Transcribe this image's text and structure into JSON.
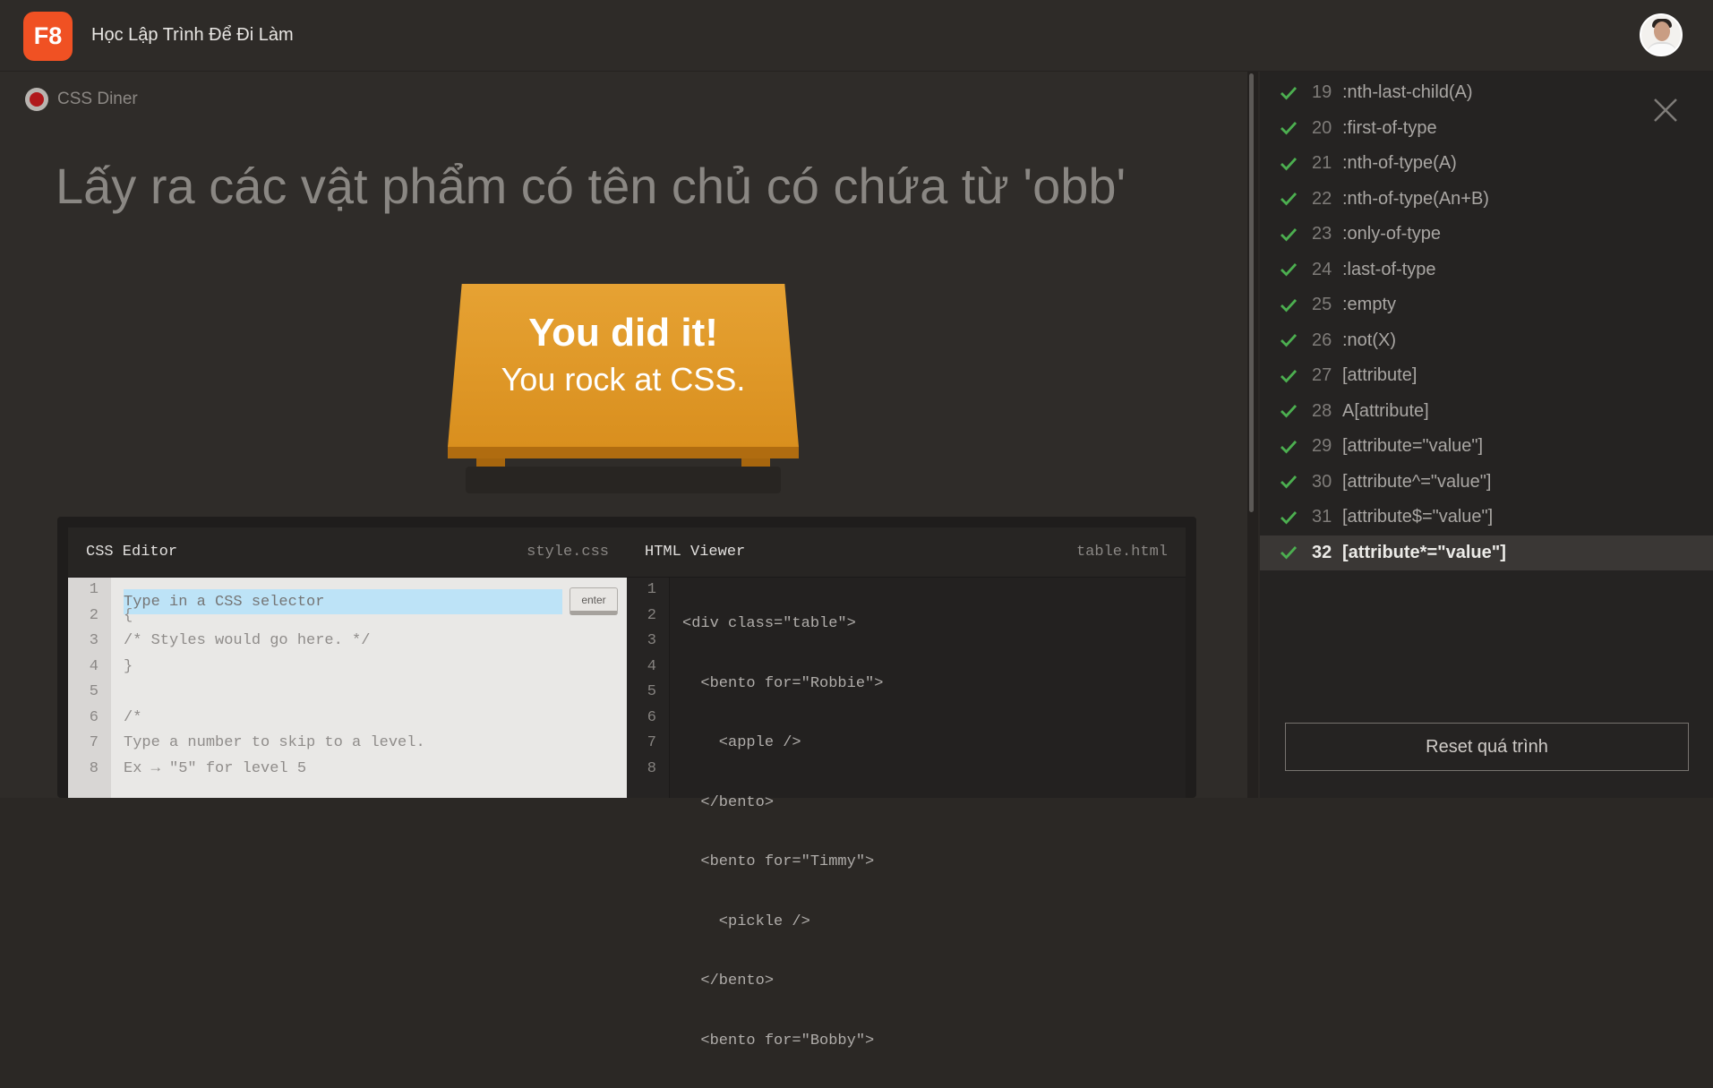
{
  "header": {
    "logo_text": "F8",
    "brand_name": "Học Lập Trình Để Đi Làm",
    "avatar": "user-avatar"
  },
  "game": {
    "app_label": "CSS Diner",
    "instruction": "Lấy ra các vật phẩm có tên chủ có chứa từ 'obb'",
    "table_line1": "You did it!",
    "table_line2": "You rock at CSS."
  },
  "css_editor": {
    "title": "CSS Editor",
    "filename": "style.css",
    "input_placeholder": "Type in a CSS selector",
    "enter_label": "enter",
    "line_numbers": [
      "1",
      "2",
      "3",
      "4",
      "5",
      "6",
      "7",
      "8"
    ],
    "lines": [
      "{",
      "/* Styles would go here. */",
      "}",
      "",
      "/*",
      "Type a number to skip to a level.",
      "Ex → \"5\" for level 5"
    ]
  },
  "html_viewer": {
    "title": "HTML Viewer",
    "filename": "table.html",
    "line_numbers": [
      "1",
      "2",
      "3",
      "4",
      "5",
      "6",
      "7",
      "8"
    ],
    "lines": [
      "<div class=\"table\">",
      "  <bento for=\"Robbie\">",
      "    <apple />",
      "  </bento>",
      "  <bento for=\"Timmy\">",
      "    <pickle />",
      "  </bento>",
      "  <bento for=\"Bobby\">"
    ]
  },
  "sidebar": {
    "levels": [
      {
        "num": "19",
        "label": ":nth-last-child(A)",
        "done": true,
        "active": false
      },
      {
        "num": "20",
        "label": ":first-of-type",
        "done": true,
        "active": false
      },
      {
        "num": "21",
        "label": ":nth-of-type(A)",
        "done": true,
        "active": false
      },
      {
        "num": "22",
        "label": ":nth-of-type(An+B)",
        "done": true,
        "active": false
      },
      {
        "num": "23",
        "label": ":only-of-type",
        "done": true,
        "active": false
      },
      {
        "num": "24",
        "label": ":last-of-type",
        "done": true,
        "active": false
      },
      {
        "num": "25",
        "label": ":empty",
        "done": true,
        "active": false
      },
      {
        "num": "26",
        "label": ":not(X)",
        "done": true,
        "active": false
      },
      {
        "num": "27",
        "label": "[attribute]",
        "done": true,
        "active": false
      },
      {
        "num": "28",
        "label": "A[attribute]",
        "done": true,
        "active": false
      },
      {
        "num": "29",
        "label": "[attribute=\"value\"]",
        "done": true,
        "active": false
      },
      {
        "num": "30",
        "label": "[attribute^=\"value\"]",
        "done": true,
        "active": false
      },
      {
        "num": "31",
        "label": "[attribute$=\"value\"]",
        "done": true,
        "active": false
      },
      {
        "num": "32",
        "label": "[attribute*=\"value\"]",
        "done": true,
        "active": true
      }
    ],
    "reset_label": "Reset quá trình"
  },
  "colors": {
    "accent": "#f05123",
    "check": "#4caf50",
    "table": "#e09a29",
    "input_highlight": "#bde3f7"
  }
}
